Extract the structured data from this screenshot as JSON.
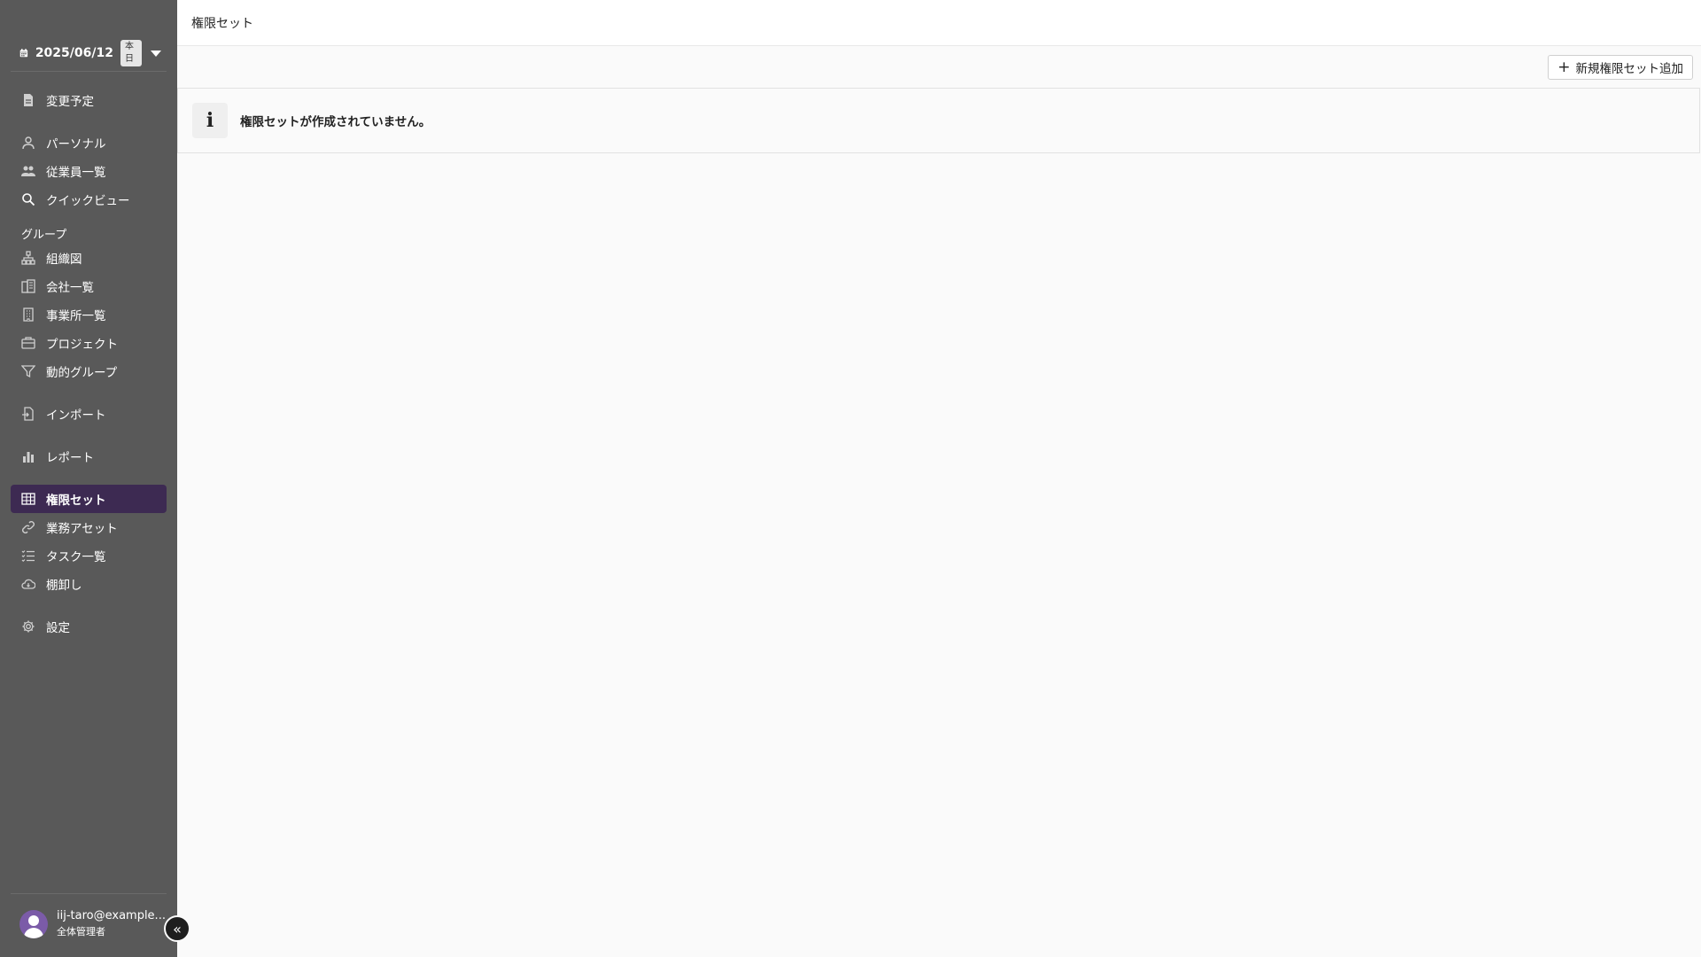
{
  "sidebar": {
    "date": "2025/06/12",
    "today_badge": "本日",
    "items_top": [
      {
        "label": "変更予定",
        "icon": "document-icon"
      }
    ],
    "items_personal": [
      {
        "label": "パーソナル",
        "icon": "person-icon"
      },
      {
        "label": "従業員一覧",
        "icon": "users-icon"
      },
      {
        "label": "クイックビュー",
        "icon": "search-icon"
      }
    ],
    "group_label": "グループ",
    "items_group": [
      {
        "label": "組織図",
        "icon": "org-chart-icon"
      },
      {
        "label": "会社一覧",
        "icon": "company-icon"
      },
      {
        "label": "事業所一覧",
        "icon": "building-icon"
      },
      {
        "label": "プロジェクト",
        "icon": "briefcase-icon"
      },
      {
        "label": "動的グループ",
        "icon": "filter-icon"
      }
    ],
    "import_label": "インポート",
    "report_label": "レポート",
    "items_admin": [
      {
        "label": "権限セット",
        "icon": "grid-icon",
        "active": true
      },
      {
        "label": "業務アセット",
        "icon": "link-icon"
      },
      {
        "label": "タスク一覧",
        "icon": "task-list-icon"
      },
      {
        "label": "棚卸し",
        "icon": "cloud-icon"
      }
    ],
    "settings_label": "設定",
    "user": {
      "email": "iij-taro@example...",
      "role": "全体管理者"
    },
    "collapse_glyph": "«"
  },
  "header": {
    "title": "権限セット"
  },
  "toolbar": {
    "add_label": "新規権限セット追加",
    "add_glyph": "+"
  },
  "info": {
    "icon_glyph": "i",
    "message": "権限セットが作成されていません。"
  }
}
